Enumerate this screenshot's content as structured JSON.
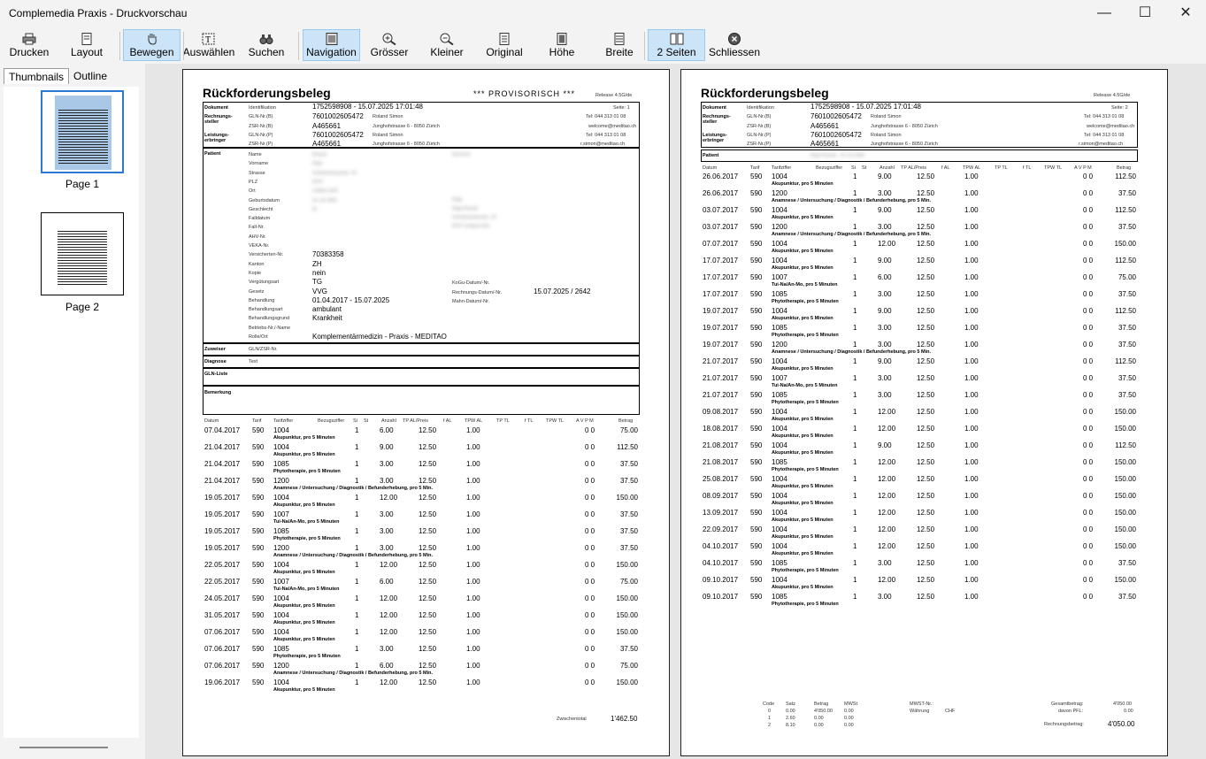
{
  "window": {
    "title": "Complemedia Praxis - Druckvorschau",
    "minimize": "—",
    "maximize": "☐",
    "close": "✕"
  },
  "toolbar": [
    {
      "label": "Drucken",
      "icon": "printer-icon",
      "active": false
    },
    {
      "label": "Layout",
      "icon": "page-layout-icon",
      "active": false
    },
    {
      "label": "Bewegen",
      "icon": "hand-icon",
      "active": true
    },
    {
      "label": "Auswählen",
      "icon": "text-select-icon",
      "active": false
    },
    {
      "label": "Suchen",
      "icon": "binoculars-icon",
      "active": false
    },
    {
      "label": "Navigation",
      "icon": "navigation-icon",
      "active": true
    },
    {
      "label": "Grösser",
      "icon": "zoom-in-icon",
      "active": false
    },
    {
      "label": "Kleiner",
      "icon": "zoom-out-icon",
      "active": false
    },
    {
      "label": "Original",
      "icon": "actual-size-icon",
      "active": false
    },
    {
      "label": "Höhe",
      "icon": "fit-height-icon",
      "active": false
    },
    {
      "label": "Breite",
      "icon": "fit-width-icon",
      "active": false
    },
    {
      "label": "2 Seiten",
      "icon": "two-pages-icon",
      "active": true
    },
    {
      "label": "Schliessen",
      "icon": "close-circle-icon",
      "active": false
    }
  ],
  "tabs": [
    "Thumbnails",
    "Outline"
  ],
  "thumbnails": [
    {
      "label": "Page 1"
    },
    {
      "label": "Page 2"
    }
  ],
  "page1": {
    "title": "Rückforderungsbeleg",
    "provisorisch": "***  PROVISORISCH  ***",
    "release": "Release 4.5G/de",
    "seite": "Seite: 1",
    "header": {
      "dokument": "Dokument",
      "identifikation": "Identifikation",
      "id_value": "1752598908 - 15.07.2025 17:01:48",
      "rs_label": "Rechnungs-steller",
      "rs_gln_label": "GLN-Nr.(B)",
      "rs_gln": "7601002605472",
      "rs_name": "Roland Simon",
      "rs_tel": "Tel: 044 313 01 08",
      "rs_zsr_label": "ZSR-Nr.(B)",
      "rs_zsr": "A465661",
      "rs_addr": "Junghofstrasse 6 - 8050 Zürich",
      "rs_mail": "welcome@meditao.ch",
      "le_label": "Leistungs-erbringer",
      "le_gln_label": "GLN-Nr.(P)",
      "le_gln": "7601002605472",
      "le_name": "Roland Simon",
      "le_tel": "Tel: 044 313 01 08",
      "le_zsr_label": "ZSR-Nr.(P)",
      "le_zsr": "A465661",
      "le_addr": "Junghofstrasse 6 - 8050 Zürich",
      "le_mail": "r.simon@meditao.ch"
    },
    "patient": {
      "label": "Patient",
      "fields": [
        {
          "k": "Name",
          "v": "",
          "blur": "Dravid"
        },
        {
          "k": "Vorname",
          "v": "",
          "blur": "Raja"
        },
        {
          "k": "Strasse",
          "v": "",
          "blur": "Schützenhausstr. 15"
        },
        {
          "k": "PLZ",
          "v": "",
          "blur": "8707"
        },
        {
          "k": "Ort",
          "v": "",
          "blur": "Uetikon A/S"
        },
        {
          "k": "Geburtsdatum",
          "v": "",
          "blur": "31.10.1964"
        },
        {
          "k": "Geschlecht",
          "v": "",
          "blur": "M"
        },
        {
          "k": "Falldatum",
          "v": ""
        },
        {
          "k": "Fall-Nr.",
          "v": ""
        },
        {
          "k": "AHV-Nr.",
          "v": ""
        },
        {
          "k": "VEKA-Nr.",
          "v": ""
        },
        {
          "k": "Versicherten-Nr.",
          "v": "70383358"
        },
        {
          "k": "Kanton",
          "v": "ZH"
        },
        {
          "k": "Kopie",
          "v": "nein"
        },
        {
          "k": "Vergütungsart",
          "v": "TG"
        },
        {
          "k": "Gesetz",
          "v": "VVG"
        },
        {
          "k": "Behandlung",
          "v": "01.04.2017 - 15.07.2025"
        },
        {
          "k": "Behandlungsart",
          "v": "ambulant"
        },
        {
          "k": "Behandlungsgrund",
          "v": "Krankheit"
        },
        {
          "k": "Betriebs-Nr./-Name",
          "v": ""
        },
        {
          "k": "Rolle/Ort",
          "v": "Komplementärmedizin - Praxis - MEDITAO"
        }
      ],
      "right_blur": [
        "Raja",
        "Raja Dravid",
        "Schützenhausstr. 15",
        "8707 Uetikon A/S"
      ],
      "kogu": "KoGu-Datum/-Nr.",
      "rechnungsdatum_label": "Rechnungs-Datum/-Nr.",
      "rechnungsdatum": "15.07.2025 / 2642",
      "mahn": "Mahn-Datum/-Nr.",
      "nn_blur": "Nummer"
    },
    "zuweiser": "Zuweiser",
    "zuweiser_gln": "GLN/ZSR-Nr.",
    "diagnose": "Diagnose",
    "diagnose_text": "Text",
    "glnliste": "GLN-Liste",
    "bemerkung": "Bemerkung",
    "columns": [
      "Datum",
      "Tarif",
      "Tarifziffer",
      "Bezugsziffer",
      "Si",
      "St",
      "Anzahl",
      "TP AL/Preis",
      "f AL",
      "TPW AL",
      "TP TL",
      "f TL",
      "TPW TL",
      "A V P M",
      "Betrag"
    ],
    "rows": [
      [
        "07.04.2017",
        "590",
        "1004",
        "1",
        "6.00",
        "12.50",
        "1.00",
        "0 0",
        "75.00",
        "Akupunktur, pro 5 Minuten"
      ],
      [
        "21.04.2017",
        "590",
        "1004",
        "1",
        "9.00",
        "12.50",
        "1.00",
        "0 0",
        "112.50",
        "Akupunktur, pro 5 Minuten"
      ],
      [
        "21.04.2017",
        "590",
        "1085",
        "1",
        "3.00",
        "12.50",
        "1.00",
        "0 0",
        "37.50",
        "Phytotherapie, pro 5 Minuten"
      ],
      [
        "21.04.2017",
        "590",
        "1200",
        "1",
        "3.00",
        "12.50",
        "1.00",
        "0 0",
        "37.50",
        "Anamnese / Untersuchung / Diagnostik / Befunderhebung, pro 5 Min."
      ],
      [
        "19.05.2017",
        "590",
        "1004",
        "1",
        "12.00",
        "12.50",
        "1.00",
        "0 0",
        "150.00",
        "Akupunktur, pro 5 Minuten"
      ],
      [
        "19.05.2017",
        "590",
        "1007",
        "1",
        "3.00",
        "12.50",
        "1.00",
        "0 0",
        "37.50",
        "Tui-Na/An-Mo, pro 5 Minuten"
      ],
      [
        "19.05.2017",
        "590",
        "1085",
        "1",
        "3.00",
        "12.50",
        "1.00",
        "0 0",
        "37.50",
        "Phytotherapie, pro 5 Minuten"
      ],
      [
        "19.05.2017",
        "590",
        "1200",
        "1",
        "3.00",
        "12.50",
        "1.00",
        "0 0",
        "37.50",
        "Anamnese / Untersuchung / Diagnostik / Befunderhebung, pro 5 Min."
      ],
      [
        "22.05.2017",
        "590",
        "1004",
        "1",
        "12.00",
        "12.50",
        "1.00",
        "0 0",
        "150.00",
        "Akupunktur, pro 5 Minuten"
      ],
      [
        "22.05.2017",
        "590",
        "1007",
        "1",
        "6.00",
        "12.50",
        "1.00",
        "0 0",
        "75.00",
        "Tui-Na/An-Mo, pro 5 Minuten"
      ],
      [
        "24.05.2017",
        "590",
        "1004",
        "1",
        "12.00",
        "12.50",
        "1.00",
        "0 0",
        "150.00",
        "Akupunktur, pro 5 Minuten"
      ],
      [
        "31.05.2017",
        "590",
        "1004",
        "1",
        "12.00",
        "12.50",
        "1.00",
        "0 0",
        "150.00",
        "Akupunktur, pro 5 Minuten"
      ],
      [
        "07.06.2017",
        "590",
        "1004",
        "1",
        "12.00",
        "12.50",
        "1.00",
        "0 0",
        "150.00",
        "Akupunktur, pro 5 Minuten"
      ],
      [
        "07.06.2017",
        "590",
        "1085",
        "1",
        "3.00",
        "12.50",
        "1.00",
        "0 0",
        "37.50",
        "Phytotherapie, pro 5 Minuten"
      ],
      [
        "07.06.2017",
        "590",
        "1200",
        "1",
        "6.00",
        "12.50",
        "1.00",
        "0 0",
        "75.00",
        "Anamnese / Untersuchung / Diagnostik / Befunderhebung, pro 5 Min."
      ],
      [
        "19.06.2017",
        "590",
        "1004",
        "1",
        "12.00",
        "12.50",
        "1.00",
        "0 0",
        "150.00",
        "Akupunktur, pro 5 Minuten"
      ]
    ],
    "zwischentotal_label": "Zwischentotal",
    "zwischentotal": "1'462.50"
  },
  "page2": {
    "title": "Rückforderungsbeleg",
    "release": "Release 4.5G/de",
    "seite": "Seite: 2",
    "patient_label": "Patient",
    "patient_blur": "Raja Dravid - 31.10.1964",
    "rows": [
      [
        "26.06.2017",
        "590",
        "1004",
        "1",
        "9.00",
        "12.50",
        "1.00",
        "0 0",
        "112.50",
        "Akupunktur, pro 5 Minuten"
      ],
      [
        "26.06.2017",
        "590",
        "1200",
        "1",
        "3.00",
        "12.50",
        "1.00",
        "0 0",
        "37.50",
        "Anamnese / Untersuchung / Diagnostik / Befunderhebung, pro 5 Min."
      ],
      [
        "03.07.2017",
        "590",
        "1004",
        "1",
        "9.00",
        "12.50",
        "1.00",
        "0 0",
        "112.50",
        "Akupunktur, pro 5 Minuten"
      ],
      [
        "03.07.2017",
        "590",
        "1200",
        "1",
        "3.00",
        "12.50",
        "1.00",
        "0 0",
        "37.50",
        "Anamnese / Untersuchung / Diagnostik / Befunderhebung, pro 5 Min."
      ],
      [
        "07.07.2017",
        "590",
        "1004",
        "1",
        "12.00",
        "12.50",
        "1.00",
        "0 0",
        "150.00",
        "Akupunktur, pro 5 Minuten"
      ],
      [
        "17.07.2017",
        "590",
        "1004",
        "1",
        "9.00",
        "12.50",
        "1.00",
        "0 0",
        "112.50",
        "Akupunktur, pro 5 Minuten"
      ],
      [
        "17.07.2017",
        "590",
        "1007",
        "1",
        "6.00",
        "12.50",
        "1.00",
        "0 0",
        "75.00",
        "Tui-Na/An-Mo, pro 5 Minuten"
      ],
      [
        "17.07.2017",
        "590",
        "1085",
        "1",
        "3.00",
        "12.50",
        "1.00",
        "0 0",
        "37.50",
        "Phytotherapie, pro 5 Minuten"
      ],
      [
        "19.07.2017",
        "590",
        "1004",
        "1",
        "9.00",
        "12.50",
        "1.00",
        "0 0",
        "112.50",
        "Akupunktur, pro 5 Minuten"
      ],
      [
        "19.07.2017",
        "590",
        "1085",
        "1",
        "3.00",
        "12.50",
        "1.00",
        "0 0",
        "37.50",
        "Phytotherapie, pro 5 Minuten"
      ],
      [
        "19.07.2017",
        "590",
        "1200",
        "1",
        "3.00",
        "12.50",
        "1.00",
        "0 0",
        "37.50",
        "Anamnese / Untersuchung / Diagnostik / Befunderhebung, pro 5 Min."
      ],
      [
        "21.07.2017",
        "590",
        "1004",
        "1",
        "9.00",
        "12.50",
        "1.00",
        "0 0",
        "112.50",
        "Akupunktur, pro 5 Minuten"
      ],
      [
        "21.07.2017",
        "590",
        "1007",
        "1",
        "3.00",
        "12.50",
        "1.00",
        "0 0",
        "37.50",
        "Tui-Na/An-Mo, pro 5 Minuten"
      ],
      [
        "21.07.2017",
        "590",
        "1085",
        "1",
        "3.00",
        "12.50",
        "1.00",
        "0 0",
        "37.50",
        "Phytotherapie, pro 5 Minuten"
      ],
      [
        "09.08.2017",
        "590",
        "1004",
        "1",
        "12.00",
        "12.50",
        "1.00",
        "0 0",
        "150.00",
        "Akupunktur, pro 5 Minuten"
      ],
      [
        "18.08.2017",
        "590",
        "1004",
        "1",
        "12.00",
        "12.50",
        "1.00",
        "0 0",
        "150.00",
        "Akupunktur, pro 5 Minuten"
      ],
      [
        "21.08.2017",
        "590",
        "1004",
        "1",
        "9.00",
        "12.50",
        "1.00",
        "0 0",
        "112.50",
        "Akupunktur, pro 5 Minuten"
      ],
      [
        "21.08.2017",
        "590",
        "1085",
        "1",
        "12.00",
        "12.50",
        "1.00",
        "0 0",
        "150.00",
        "Phytotherapie, pro 5 Minuten"
      ],
      [
        "25.08.2017",
        "590",
        "1004",
        "1",
        "12.00",
        "12.50",
        "1.00",
        "0 0",
        "150.00",
        "Akupunktur, pro 5 Minuten"
      ],
      [
        "08.09.2017",
        "590",
        "1004",
        "1",
        "12.00",
        "12.50",
        "1.00",
        "0 0",
        "150.00",
        "Akupunktur, pro 5 Minuten"
      ],
      [
        "13.09.2017",
        "590",
        "1004",
        "1",
        "12.00",
        "12.50",
        "1.00",
        "0 0",
        "150.00",
        "Akupunktur, pro 5 Minuten"
      ],
      [
        "22.09.2017",
        "590",
        "1004",
        "1",
        "12.00",
        "12.50",
        "1.00",
        "0 0",
        "150.00",
        "Akupunktur, pro 5 Minuten"
      ],
      [
        "04.10.2017",
        "590",
        "1004",
        "1",
        "12.00",
        "12.50",
        "1.00",
        "0 0",
        "150.00",
        "Akupunktur, pro 5 Minuten"
      ],
      [
        "04.10.2017",
        "590",
        "1085",
        "1",
        "3.00",
        "12.50",
        "1.00",
        "0 0",
        "37.50",
        "Phytotherapie, pro 5 Minuten"
      ],
      [
        "09.10.2017",
        "590",
        "1004",
        "1",
        "12.00",
        "12.50",
        "1.00",
        "0 0",
        "150.00",
        "Akupunktur, pro 5 Minuten"
      ],
      [
        "09.10.2017",
        "590",
        "1085",
        "1",
        "3.00",
        "12.50",
        "1.00",
        "0 0",
        "37.50",
        "Phytotherapie, pro 5 Minuten"
      ]
    ],
    "summary": {
      "mwst_head": [
        "Code",
        "Satz",
        "Betrag",
        "MWSt"
      ],
      "mwst_rows": [
        [
          "0",
          "0.00",
          "4'050.00",
          "0.00"
        ],
        [
          "1",
          "2.60",
          "0.00",
          "0.00"
        ],
        [
          "2",
          "8.10",
          "0.00",
          "0.00"
        ]
      ],
      "mwst_nr": "MWST-Nr.:",
      "waehrung": "Währung",
      "waehrung_value": "CHF",
      "gesamtbetrag": "Gesamtbetrag:",
      "gesamtbetrag_value": "4'050.00",
      "davon_pfl": "davon PFL:",
      "davon_pfl_value": "0.00",
      "rechnungsbetrag": "Rechnungsbetrag:",
      "rechnungsbetrag_value": "4'050.00"
    }
  }
}
